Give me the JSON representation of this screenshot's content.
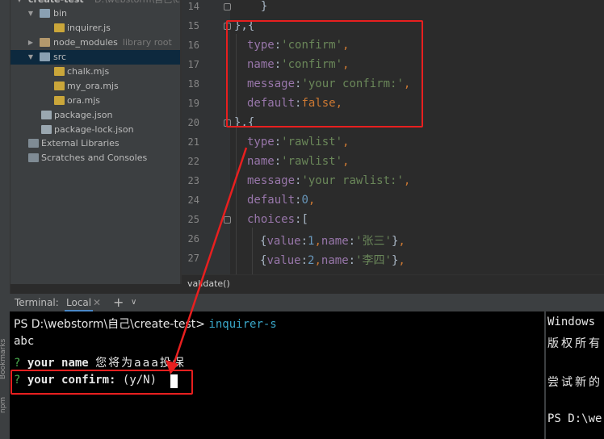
{
  "left_strip": {
    "bookmarks": "Bookmarks",
    "npm": "npm"
  },
  "tree": {
    "root": {
      "name": "create-test",
      "path": "D:\\webstorm\\自己\\cre"
    },
    "items": [
      {
        "name": "bin",
        "kind": "folder"
      },
      {
        "name": "inquirer.js",
        "kind": "file"
      },
      {
        "name": "node_modules",
        "kind": "folder-orange",
        "extra": "library root"
      },
      {
        "name": "src",
        "kind": "folder"
      },
      {
        "name": "chalk.mjs",
        "kind": "file"
      },
      {
        "name": "my_ora.mjs",
        "kind": "file"
      },
      {
        "name": "ora.mjs",
        "kind": "file"
      },
      {
        "name": "package.json",
        "kind": "json"
      },
      {
        "name": "package-lock.json",
        "kind": "json"
      },
      {
        "name": "External Libraries",
        "kind": "lib"
      },
      {
        "name": "Scratches and Consoles",
        "kind": "lib"
      }
    ]
  },
  "editor": {
    "line_numbers": [
      "14",
      "15",
      "16",
      "17",
      "18",
      "19",
      "20",
      "21",
      "22",
      "23",
      "24",
      "25",
      "26",
      "27"
    ],
    "breadcrumb": "validate()"
  },
  "terminal": {
    "title": "Terminal:",
    "tab": "Local",
    "lines": {
      "prompt": "PS D:\\webstorm\\自己\\create-test> ",
      "command": "inquirer-s",
      "out1": "abc",
      "q1_mark": "?",
      "q1_label": "your name",
      "q1_answer": "您将为aaa投保",
      "q2_mark": "?",
      "q2_label": "your confirm:",
      "q2_hint": "(y/N)"
    },
    "right_pane": [
      "Windows",
      "版权所有",
      "尝试新的",
      "PS D:\\we"
    ]
  },
  "annotation_color": "#e81f1f"
}
